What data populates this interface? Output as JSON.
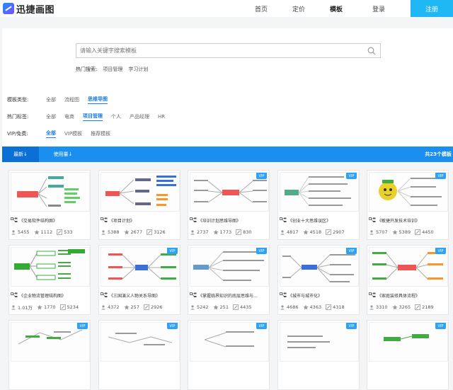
{
  "header": {
    "logo_text": "迅捷画图",
    "nav": [
      "首页",
      "定价",
      "模板",
      "登录"
    ],
    "active_nav": "模板",
    "register": "注册"
  },
  "search": {
    "placeholder": "请输入关键字搜索模板",
    "hot_label": "热门搜索:",
    "hot_items": [
      "项目管理",
      "学习计划"
    ]
  },
  "filters": {
    "type": {
      "label": "模板类型:",
      "options": [
        "全部",
        "流程图",
        "思维导图"
      ],
      "active": "思维导图"
    },
    "tags": {
      "label": "热门标签:",
      "options": [
        "全部",
        "电商",
        "项目管理",
        "个人",
        "产品经理",
        "HR"
      ],
      "active": "项目管理"
    },
    "vip": {
      "label": "VIP/免费:",
      "options": [
        "全部",
        "VIP模板",
        "推荐模板"
      ],
      "active": "全部"
    }
  },
  "sortbar": {
    "latest": "最新↓",
    "most_used": "使用量↓",
    "total": "共23个模板"
  },
  "colors": {
    "accent": "#1a8ff0",
    "register": "#1fb8f5",
    "vip": "#2ea2f5",
    "active_text": "#1a7de0"
  },
  "vip_label": "VIP",
  "cards": [
    {
      "title": "《交易软件结构图》",
      "views": "5455",
      "likes": "1112",
      "uses": "533",
      "vip": false
    },
    {
      "title": "《项目计划》",
      "views": "5388",
      "likes": "2677",
      "uses": "3126",
      "vip": false
    },
    {
      "title": "《培训计划思维导图》",
      "views": "2737",
      "likes": "1773",
      "uses": "830",
      "vip": true
    },
    {
      "title": "《创业十大思维误区》",
      "views": "4817",
      "likes": "4518",
      "uses": "2907",
      "vip": true
    },
    {
      "title": "《敏捷开发技术培训》",
      "views": "5707",
      "likes": "5389",
      "uses": "4450",
      "vip": true
    },
    {
      "title": "《企业物流管理结构图》",
      "views": "1.01万",
      "likes": "1770",
      "uses": "5234",
      "vip": false
    },
    {
      "title": "《三国演义人物关系导图》",
      "views": "4372",
      "likes": "257",
      "uses": "2926",
      "vip": true
    },
    {
      "title": "《掌握临界知识的底层思维与...",
      "views": "5242",
      "likes": "251",
      "uses": "4435",
      "vip": true
    },
    {
      "title": "《城市与城市化》",
      "views": "4686",
      "likes": "4363",
      "uses": "4318",
      "vip": true
    },
    {
      "title": "《家庭装修具体流程》",
      "views": "3310",
      "likes": "3265",
      "uses": "2189",
      "vip": true
    },
    {
      "title": "",
      "views": "",
      "likes": "",
      "uses": "",
      "vip": true
    },
    {
      "title": "",
      "views": "",
      "likes": "",
      "uses": "",
      "vip": true
    },
    {
      "title": "",
      "views": "",
      "likes": "",
      "uses": "",
      "vip": true
    },
    {
      "title": "",
      "views": "",
      "likes": "",
      "uses": "",
      "vip": true
    },
    {
      "title": "",
      "views": "",
      "likes": "",
      "uses": "",
      "vip": true
    }
  ]
}
